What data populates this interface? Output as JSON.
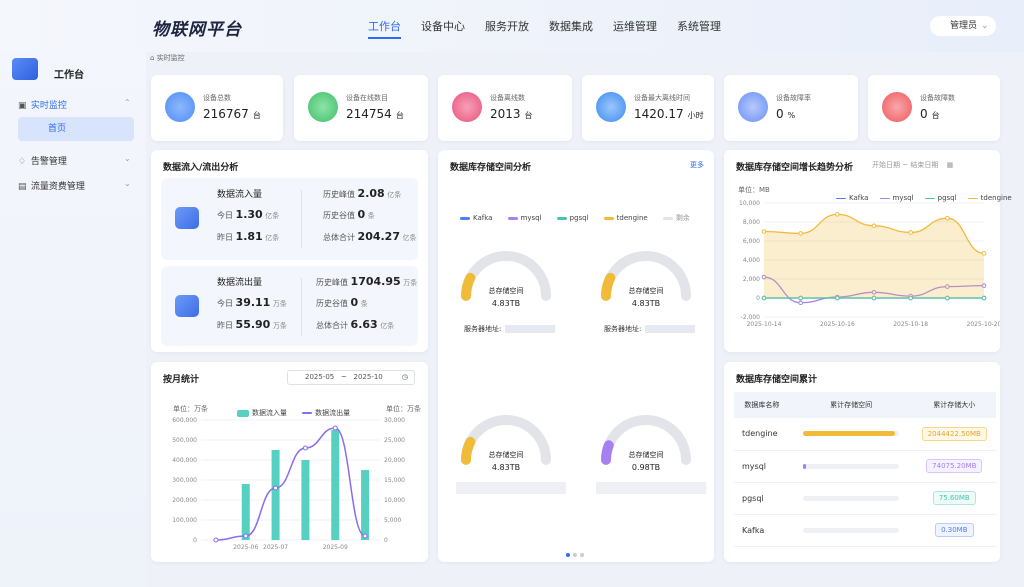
{
  "app": {
    "brand": "物联网平台",
    "user": "管理员"
  },
  "nav": [
    {
      "label": "工作台",
      "active": true
    },
    {
      "label": "设备中心"
    },
    {
      "label": "服务开放"
    },
    {
      "label": "数据集成"
    },
    {
      "label": "运维管理"
    },
    {
      "label": "系统管理"
    }
  ],
  "sidebar": {
    "title": "工作台",
    "items": [
      {
        "label": "实时监控",
        "icon": "monitor-icon",
        "expanded": true
      },
      {
        "label": "告警管理",
        "icon": "alarm-icon"
      },
      {
        "label": "流量资费管理",
        "icon": "traffic-icon"
      }
    ],
    "sub": "首页"
  },
  "breadcrumb": "实时监控",
  "stats": [
    {
      "label": "设备总数",
      "value": "216767",
      "unit": "台",
      "color": "#4b8ef7",
      "icon": "device-total-icon"
    },
    {
      "label": "设备在线数目",
      "value": "214754",
      "unit": "台",
      "color": "#3fbf6a",
      "icon": "device-online-icon"
    },
    {
      "label": "设备离线数",
      "value": "2013",
      "unit": "台",
      "color": "#e8527a",
      "icon": "device-offline-icon"
    },
    {
      "label": "设备最大离线时间",
      "value": "1420.17",
      "unit": "小时",
      "color": "#3a8bf0",
      "icon": "clock-icon"
    },
    {
      "label": "设备故障率",
      "value": "0",
      "unit": "%",
      "color": "#6a8ff5",
      "icon": "gear-icon"
    },
    {
      "label": "设备故障数",
      "value": "0",
      "unit": "台",
      "color": "#f0585e",
      "icon": "alert-icon"
    }
  ],
  "flow": {
    "title": "数据流入/流出分析",
    "in": {
      "title": "数据流入量",
      "today_label": "今日",
      "today": "1.30",
      "today_unit": "亿条",
      "yest_label": "昨日",
      "yest": "1.81",
      "yest_unit": "亿条",
      "peak_label": "历史峰值",
      "peak": "2.08",
      "peak_unit": "亿条",
      "valley_label": "历史谷值",
      "valley": "0",
      "valley_unit": "条",
      "total_label": "总体合计",
      "total": "204.27",
      "total_unit": "亿条"
    },
    "out": {
      "title": "数据流出量",
      "today_label": "今日",
      "today": "39.11",
      "today_unit": "万条",
      "yest_label": "昨日",
      "yest": "55.90",
      "yest_unit": "万条",
      "peak_label": "历史峰值",
      "peak": "1704.95",
      "peak_unit": "万条",
      "valley_label": "历史谷值",
      "valley": "0",
      "valley_unit": "条",
      "total_label": "总体合计",
      "total": "6.63",
      "total_unit": "亿条"
    }
  },
  "storage": {
    "title": "数据库存储空间分析",
    "more": "更多",
    "legend": [
      {
        "name": "Kafka",
        "color": "#4e7ff5"
      },
      {
        "name": "mysql",
        "color": "#a77ff0"
      },
      {
        "name": "pgsql",
        "color": "#44c7b0"
      },
      {
        "name": "tdengine",
        "color": "#f1bb3a"
      },
      {
        "name": "剩余",
        "color": "#e2e4ea"
      }
    ],
    "gauges": [
      {
        "label": "总存储空间",
        "value": "4.83TB",
        "fill": 0.15,
        "color": "#f1bb3a"
      },
      {
        "label": "总存储空间",
        "value": "4.83TB",
        "fill": 0.15,
        "color": "#f1bb3a"
      },
      {
        "label": "总存储空间",
        "value": "4.83TB",
        "fill": 0.15,
        "color": "#f1bb3a"
      },
      {
        "label": "总存储空间",
        "value": "0.98TB",
        "fill": 0.12,
        "color": "#a77ff0"
      }
    ],
    "server_label": "服务器地址:"
  },
  "monthly": {
    "title": "按月统计",
    "date_start": "2025-05",
    "date_sep": "~",
    "date_end": "2025-10",
    "legend_in": "数据流入量",
    "legend_out": "数据流出量",
    "left_unit": "单位：万条",
    "right_unit": "单位：万条"
  },
  "growth": {
    "title": "数据库存储空间增长趋势分析",
    "start_ph": "开始日期",
    "sep": "~",
    "end_ph": "结束日期",
    "unit": "单位：MB"
  },
  "cumulative": {
    "title": "数据库存储空间累计",
    "headers": [
      "数据库名称",
      "累计存储空间",
      "累计存储大小"
    ],
    "rows": [
      {
        "name": "tdengine",
        "size": "2044422.50MB",
        "fill": 0.96,
        "color": "#f1bb3a"
      },
      {
        "name": "mysql",
        "size": "74075.20MB",
        "fill": 0.03,
        "color": "#a77ff0"
      },
      {
        "name": "pgsql",
        "size": "75.60MB",
        "fill": 0.0,
        "color": "#44c7b0"
      },
      {
        "name": "Kafka",
        "size": "0.30MB",
        "fill": 0.0,
        "color": "#4e7ff5"
      }
    ]
  },
  "chart_data": [
    {
      "type": "bar",
      "title": "按月统计",
      "x": [
        "2025-05",
        "2025-06",
        "2025-07",
        "2025-08",
        "2025-09",
        "2025-10"
      ],
      "xticks": [
        "2025-06",
        "2025-07",
        "2025-09"
      ],
      "series": [
        {
          "name": "数据流入量",
          "type": "bar",
          "axis": "left",
          "values": [
            0,
            280000,
            450000,
            400000,
            550000,
            350000
          ],
          "color": "#56d0c0"
        },
        {
          "name": "数据流出量",
          "type": "line",
          "axis": "right",
          "values": [
            0,
            1000,
            13000,
            23000,
            28000,
            1000
          ],
          "color": "#8a6bf2"
        }
      ],
      "ylim_left": [
        0,
        600000
      ],
      "ylim_right": [
        0,
        30000
      ],
      "yticks_left": [
        "600,000",
        "500,000",
        "400,000",
        "300,000",
        "200,000",
        "100,000",
        "0"
      ],
      "yticks_right": [
        "30,000",
        "25,000",
        "20,000",
        "15,000",
        "10,000",
        "5,000",
        "0"
      ]
    },
    {
      "type": "line",
      "title": "数据库存储空间增长趋势分析",
      "x": [
        "2025-10-14",
        "2025-10-15",
        "2025-10-16",
        "2025-10-17",
        "2025-10-18",
        "2025-10-19",
        "2025-10-20"
      ],
      "xticks": [
        "2025-10-14",
        "2025-10-16",
        "2025-10-18",
        "2025-10-20"
      ],
      "ylim": [
        -2000,
        10000
      ],
      "yticks": [
        "10,000",
        "8,000",
        "6,000",
        "4,000",
        "2,000",
        "0",
        "-2,000"
      ],
      "series": [
        {
          "name": "Kafka",
          "values": [
            0,
            0,
            0,
            0,
            0,
            0,
            0
          ],
          "color": "#4e7ff5"
        },
        {
          "name": "mysql",
          "values": [
            2200,
            -500,
            100,
            600,
            200,
            1200,
            1300
          ],
          "color": "#a77ff0"
        },
        {
          "name": "pgsql",
          "values": [
            0,
            0,
            0,
            0,
            0,
            0,
            0
          ],
          "color": "#44c7b0"
        },
        {
          "name": "tdengine",
          "values": [
            7000,
            6800,
            8800,
            7600,
            6900,
            8400,
            4700
          ],
          "color": "#f1bb3a"
        }
      ]
    }
  ]
}
